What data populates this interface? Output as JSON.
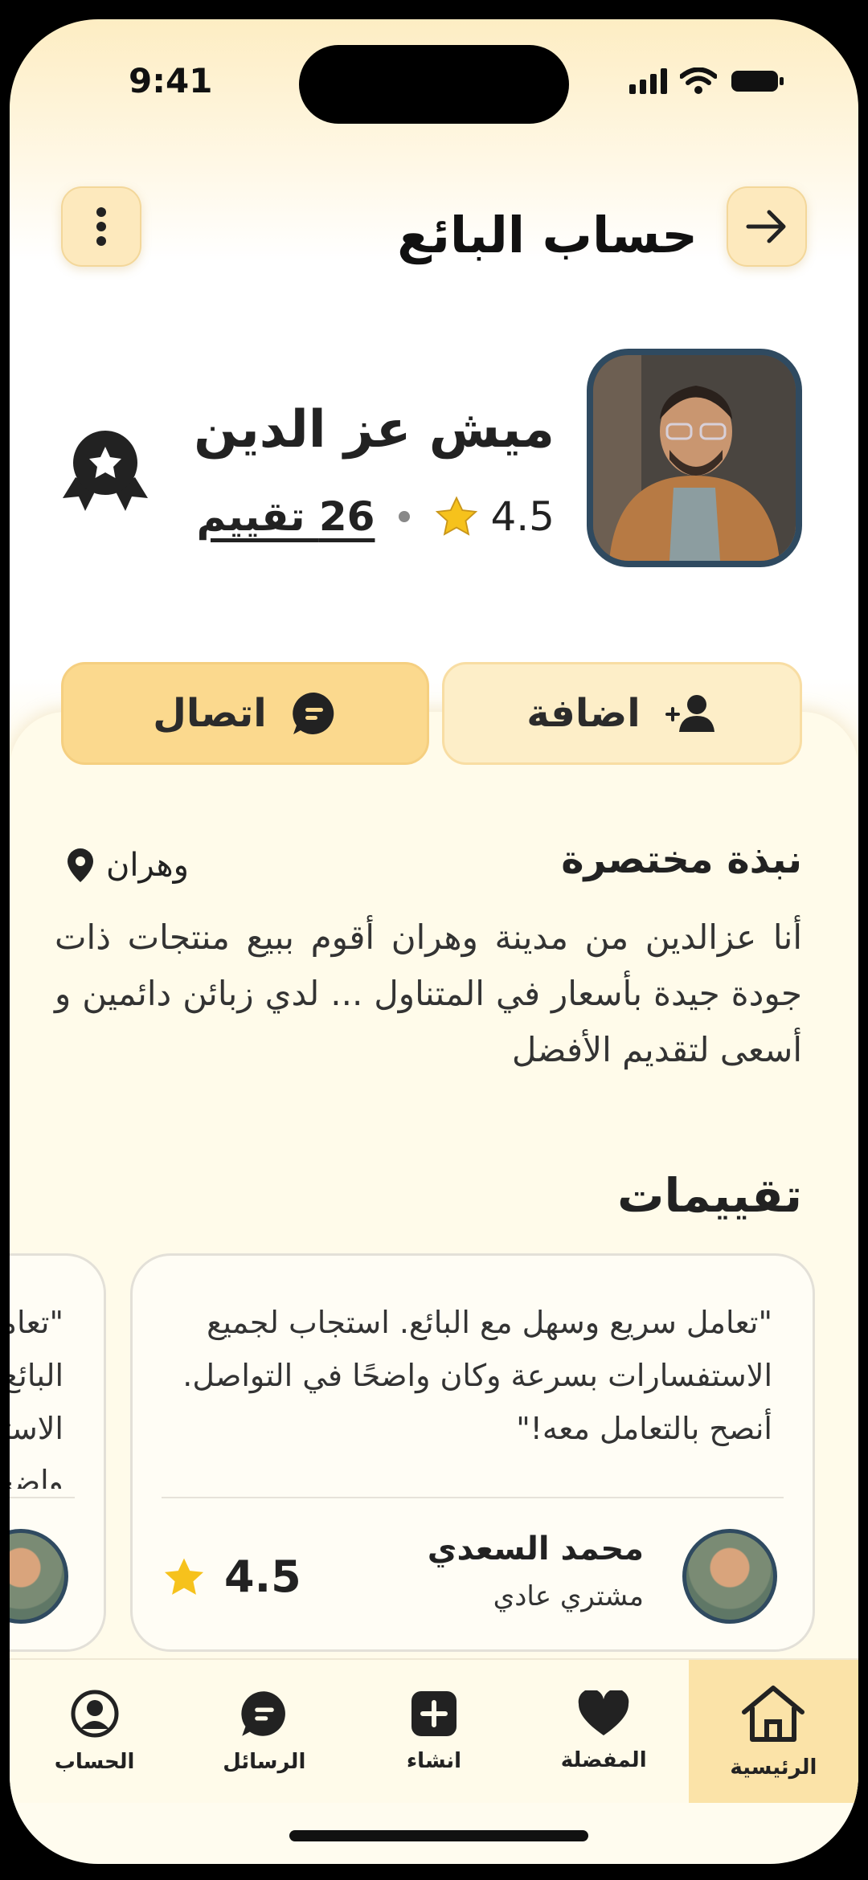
{
  "status": {
    "time": "9:41"
  },
  "header": {
    "title": "حساب البائع"
  },
  "seller": {
    "name": "ميش عز الدين",
    "rating": "4.5",
    "reviews": "26 تقييم"
  },
  "actions": {
    "add": "اضافة",
    "contact": "اتصال"
  },
  "about": {
    "title": "نبذة مختصرة",
    "city": "وهران",
    "bio": "أنا عزالدين من مدينة وهران أقوم ببيع منتجات ذات جودة جيدة بأسعار في المتناول ... لدي زبائن دائمين و أسعى لتقديم الأفضل"
  },
  "reviews": {
    "title": "تقييمات",
    "items": [
      {
        "text": "\"تعامل سريع وسهل مع البائع. استجاب لجميع الاستفسارات بسرعة وكان واضحًا في التواصل. أنصح بالتعامل معه!\"",
        "name": "محمد السعدي",
        "role": "مشتري عادي",
        "score": "4.5"
      },
      {
        "text": "\"تعامل سريع وسهل مع البائع. استجاب لجميع الاستفسارات بسرعة وكان واضحًا في التواصل. أنصح بالتعامل معه!\"",
        "name": "",
        "role": "",
        "score": ""
      }
    ]
  },
  "nav": {
    "home": "الرئيسية",
    "favorites": "المفضلة",
    "create": "انشاء",
    "messages": "الرسائل",
    "account": "الحساب"
  },
  "colors": {
    "accent": "#fbd98e",
    "star": "#f6c21c",
    "avatar_border": "#2f4a60"
  }
}
